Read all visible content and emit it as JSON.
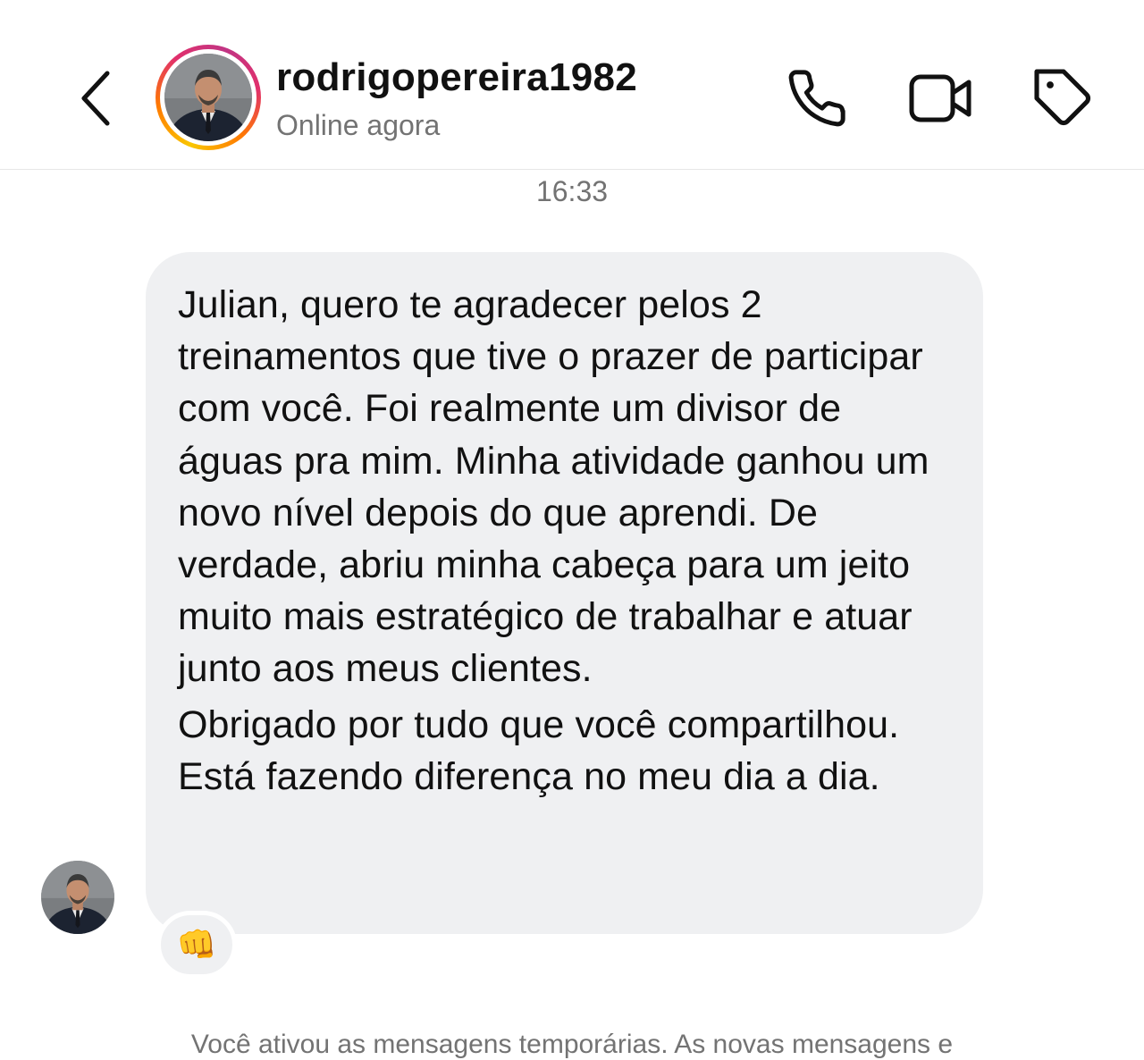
{
  "header": {
    "back_icon": "chevron-left-icon",
    "username": "rodrigopereira1982",
    "status": "Online agora",
    "actions": [
      "phone-icon",
      "video-camera-icon",
      "tag-icon"
    ]
  },
  "conversation": {
    "timestamp": "16:33",
    "message": {
      "paragraphs": [
        "Julian, quero te agradecer pelos 2 treinamentos que tive o prazer de participar com você. Foi realmente um divisor de águas pra mim. Minha atividade ganhou um novo nível depois do que aprendi. De verdade, abriu minha cabeça para um jeito muito mais estratégico de trabalhar e atuar junto aos meus clientes.",
        "Obrigado por tudo que você compartilhou. Está fazendo diferença no meu dia a dia."
      ],
      "reaction": "👊"
    },
    "system_note": "Você ativou as mensagens temporárias. As novas mensagens e"
  },
  "colors": {
    "bubble": "#eff0f2",
    "secondary_text": "#737373",
    "story_ring": [
      "#f9c600",
      "#ff7a00",
      "#e1306c",
      "#c13584"
    ]
  }
}
